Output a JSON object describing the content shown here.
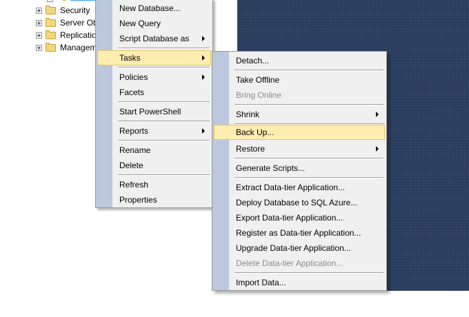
{
  "object_explorer": {
    "items": [
      {
        "label": "Security"
      },
      {
        "label": "Server Objects"
      },
      {
        "label": "Replication"
      },
      {
        "label": "Management"
      }
    ]
  },
  "context_menu": {
    "items": [
      {
        "label": "New Database..."
      },
      {
        "label": "New Query"
      },
      {
        "label": "Script Database as"
      },
      {
        "label": "Tasks"
      },
      {
        "label": "Policies"
      },
      {
        "label": "Facets"
      },
      {
        "label": "Start PowerShell"
      },
      {
        "label": "Reports"
      },
      {
        "label": "Rename"
      },
      {
        "label": "Delete"
      },
      {
        "label": "Refresh"
      },
      {
        "label": "Properties"
      }
    ]
  },
  "tasks_submenu": {
    "items": [
      {
        "label": "Detach..."
      },
      {
        "label": "Take Offline"
      },
      {
        "label": "Bring Online"
      },
      {
        "label": "Shrink"
      },
      {
        "label": "Back Up..."
      },
      {
        "label": "Restore"
      },
      {
        "label": "Generate Scripts..."
      },
      {
        "label": "Extract Data-tier Application..."
      },
      {
        "label": "Deploy Database to SQL Azure..."
      },
      {
        "label": "Export Data-tier Application..."
      },
      {
        "label": "Register as Data-tier Application..."
      },
      {
        "label": "Upgrade Data-tier Application..."
      },
      {
        "label": "Delete Data-tier Application..."
      },
      {
        "label": "Import Data..."
      }
    ]
  },
  "colors": {
    "menu_background": "#f0f0f0",
    "menu_gutter": "#bcc8dc",
    "highlight": "#fdeeb0",
    "highlight_border": "#e5c365",
    "disabled_text": "#8c8c8c",
    "desktop_background": "#2b3d5e"
  }
}
